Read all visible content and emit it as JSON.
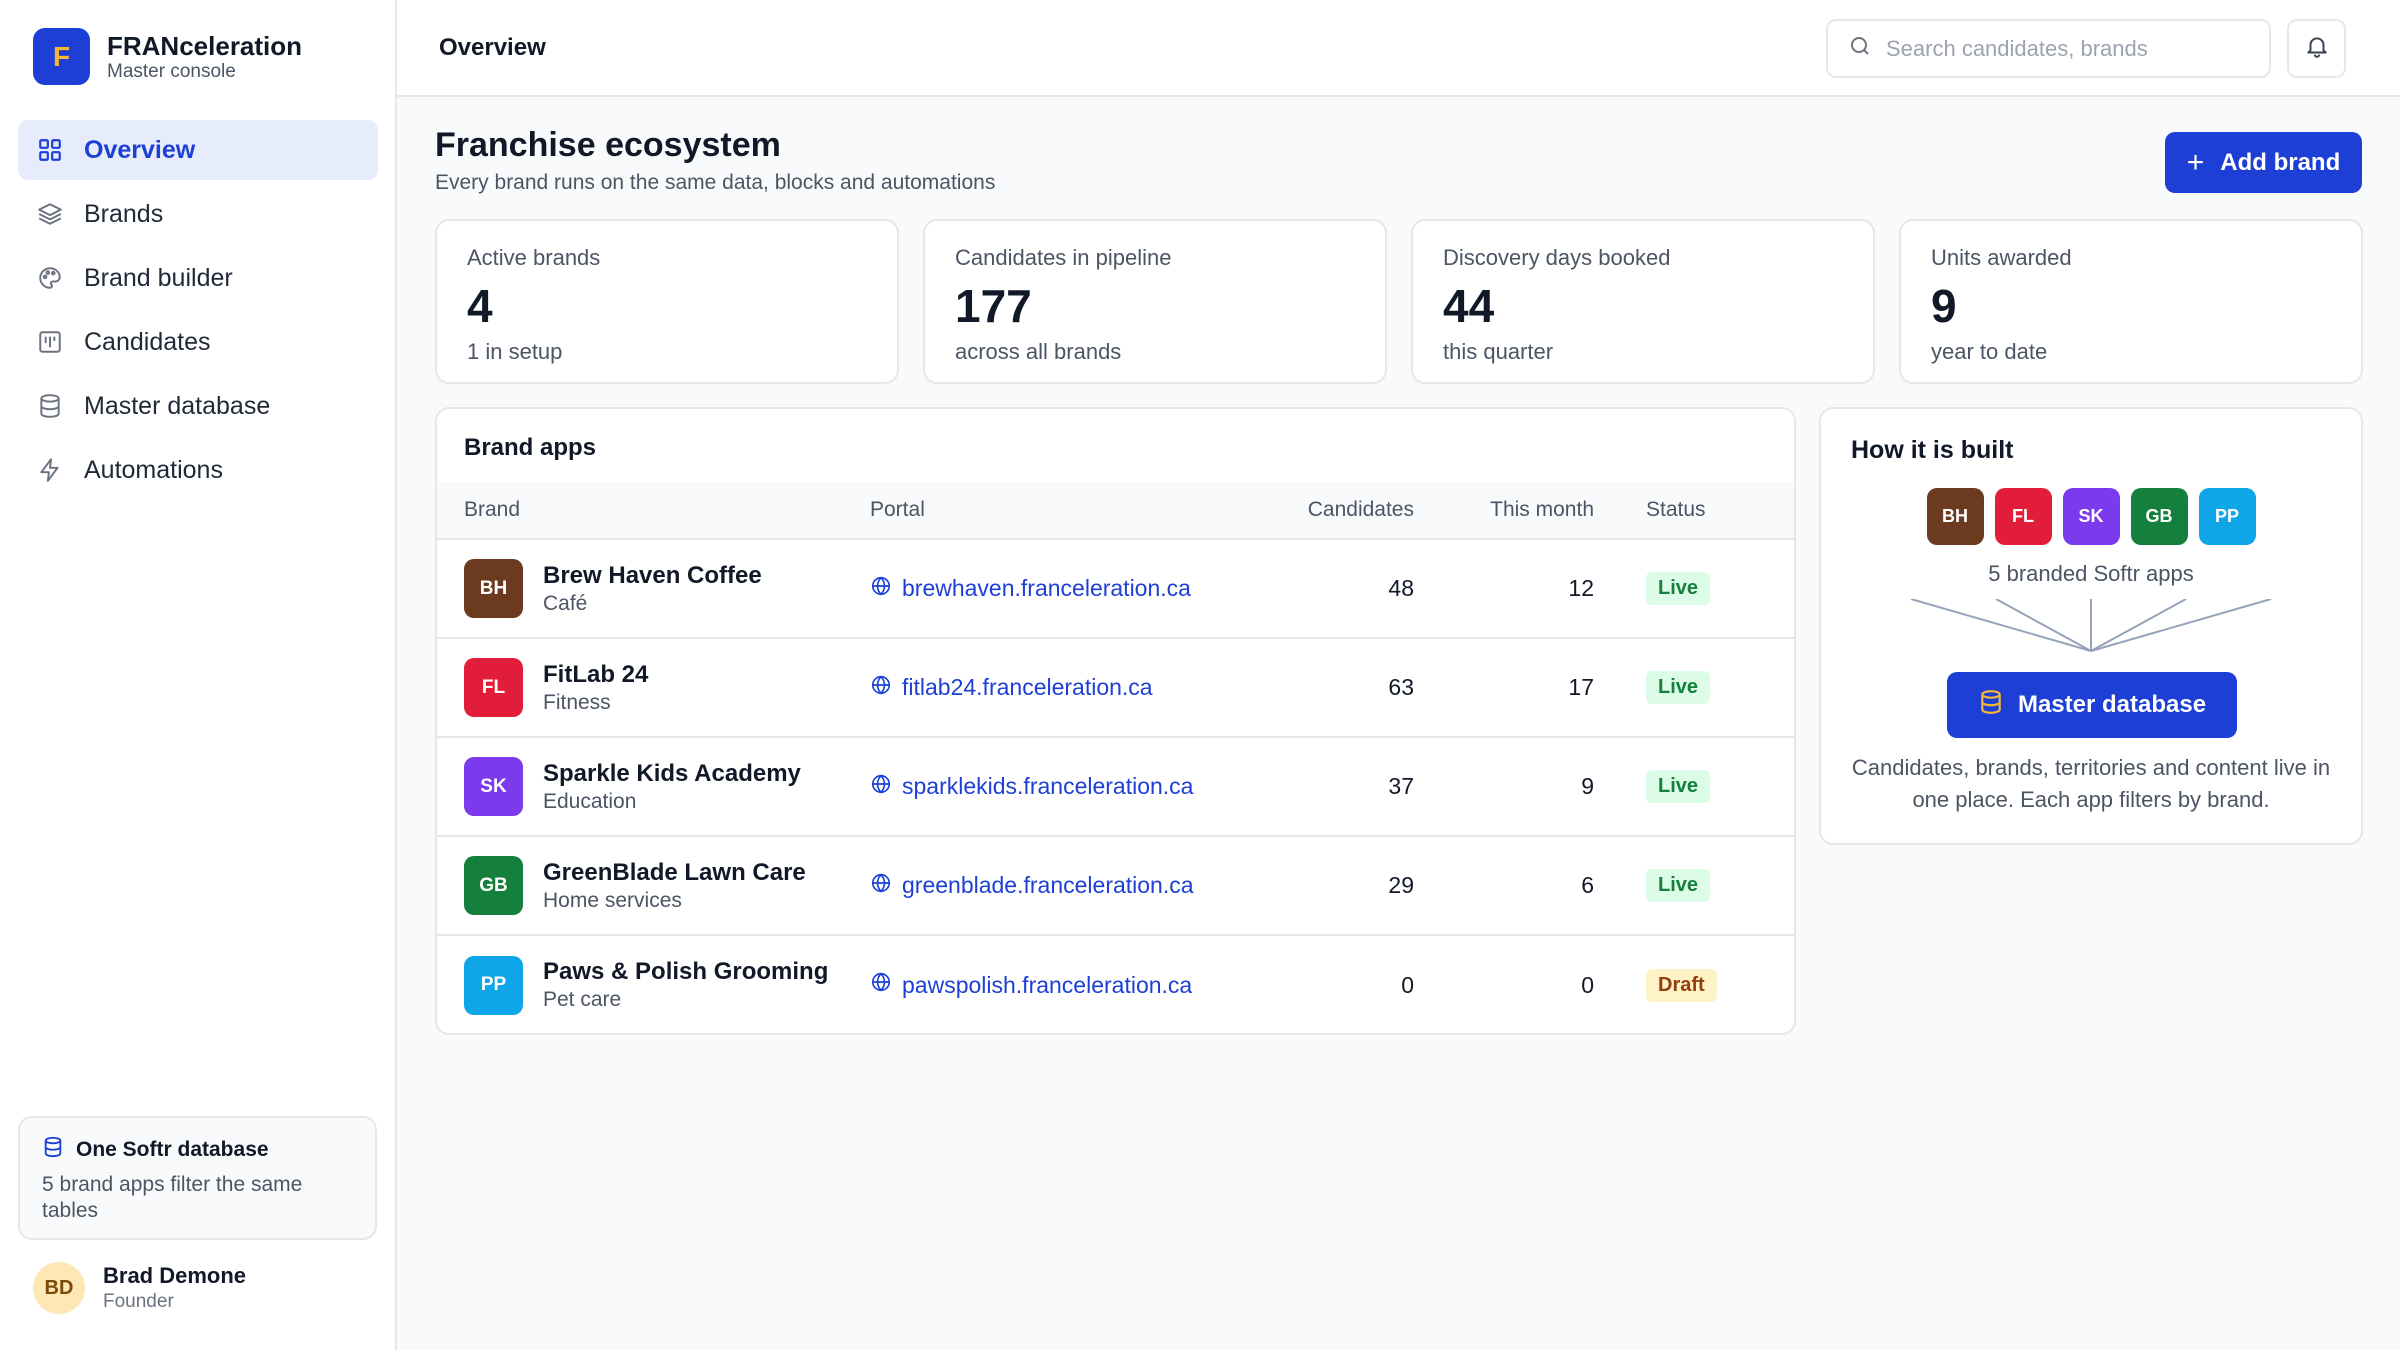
{
  "app": {
    "logo_letter": "F",
    "name": "FRANceleration",
    "subtitle": "Master console"
  },
  "sidebar": {
    "items": [
      {
        "label": "Overview",
        "icon": "grid-icon",
        "active": true
      },
      {
        "label": "Brands",
        "icon": "layers-icon",
        "active": false
      },
      {
        "label": "Brand builder",
        "icon": "palette-icon",
        "active": false
      },
      {
        "label": "Candidates",
        "icon": "kanban-icon",
        "active": false
      },
      {
        "label": "Master database",
        "icon": "database-icon",
        "active": false
      },
      {
        "label": "Automations",
        "icon": "bolt-icon",
        "active": false
      }
    ],
    "promo": {
      "title": "One Softr database",
      "text": "5 brand apps filter the same tables"
    },
    "user": {
      "initials": "BD",
      "name": "Brad Demone",
      "role": "Founder"
    }
  },
  "header": {
    "title": "Overview",
    "search_placeholder": "Search candidates, brands"
  },
  "main": {
    "title": "Franchise ecosystem",
    "subtitle": "Every brand runs on the same data, blocks and automations",
    "add_button": "Add brand",
    "stats": [
      {
        "label": "Active brands",
        "value": "4",
        "note": "1 in setup"
      },
      {
        "label": "Candidates in pipeline",
        "value": "177",
        "note": "across all brands"
      },
      {
        "label": "Discovery days booked",
        "value": "44",
        "note": "this quarter"
      },
      {
        "label": "Units awarded",
        "value": "9",
        "note": "year to date"
      }
    ],
    "apps": {
      "title": "Brand apps",
      "columns": [
        "Brand",
        "Portal",
        "Candidates",
        "This month",
        "Status"
      ],
      "rows": [
        {
          "initials": "BH",
          "name": "Brew Haven Coffee",
          "category": "Café",
          "portal": "brewhaven.franceleration.ca",
          "candidates": "48",
          "month": "12",
          "status": "Live",
          "color": "#6b3a1f"
        },
        {
          "initials": "FL",
          "name": "FitLab 24",
          "category": "Fitness",
          "portal": "fitlab24.franceleration.ca",
          "candidates": "63",
          "month": "17",
          "status": "Live",
          "color": "#e11d3a"
        },
        {
          "initials": "SK",
          "name": "Sparkle Kids Academy",
          "category": "Education",
          "portal": "sparklekids.franceleration.ca",
          "candidates": "37",
          "month": "9",
          "status": "Live",
          "color": "#7c3aed"
        },
        {
          "initials": "GB",
          "name": "GreenBlade Lawn Care",
          "category": "Home services",
          "portal": "greenblade.franceleration.ca",
          "candidates": "29",
          "month": "6",
          "status": "Live",
          "color": "#15803d"
        },
        {
          "initials": "PP",
          "name": "Paws & Polish Grooming",
          "category": "Pet care",
          "portal": "pawspolish.franceleration.ca",
          "candidates": "0",
          "month": "0",
          "status": "Draft",
          "color": "#0ea5e9"
        }
      ]
    },
    "built": {
      "title": "How it is built",
      "badges": [
        {
          "initials": "BH",
          "color": "#6b3a1f"
        },
        {
          "initials": "FL",
          "color": "#e11d3a"
        },
        {
          "initials": "SK",
          "color": "#7c3aed"
        },
        {
          "initials": "GB",
          "color": "#15803d"
        },
        {
          "initials": "PP",
          "color": "#0ea5e9"
        }
      ],
      "caption": "5 branded Softr apps",
      "db_button": "Master database",
      "description": "Candidates, brands, territories and content live in one place. Each app filters by brand."
    }
  },
  "colors": {
    "accent": "#1d3fd6",
    "live_bg": "#dcfce7",
    "live_text": "#15803d",
    "draft_bg": "#fef3c7",
    "draft_text": "#92400e"
  }
}
